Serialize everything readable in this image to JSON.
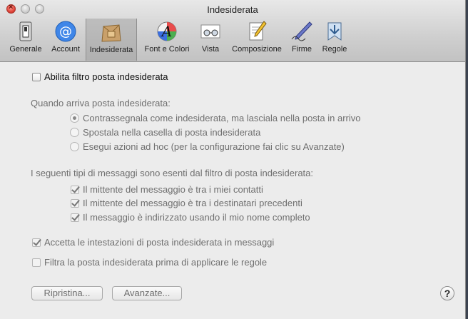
{
  "window": {
    "title": "Indesiderata"
  },
  "toolbar": {
    "items": [
      {
        "label": "Generale",
        "icon": "switch-icon"
      },
      {
        "label": "Account",
        "icon": "at-sign-icon"
      },
      {
        "label": "Indesiderata",
        "icon": "junk-mail-icon",
        "selected": true
      },
      {
        "label": "Font e Colori",
        "icon": "font-colors-icon"
      },
      {
        "label": "Vista",
        "icon": "glasses-icon"
      },
      {
        "label": "Composizione",
        "icon": "compose-pencil-icon"
      },
      {
        "label": "Firme",
        "icon": "signature-pen-icon"
      },
      {
        "label": "Regole",
        "icon": "rules-icon"
      }
    ]
  },
  "settings": {
    "enable_filter": {
      "label": "Abilita filtro posta indesiderata",
      "checked": false
    },
    "when_arrives_label": "Quando arriva posta indesiderata:",
    "radio_options": [
      {
        "label": "Contrassegnala come indesiderata, ma lasciala nella posta in arrivo",
        "selected": true
      },
      {
        "label": "Spostala nella casella di posta indesiderata",
        "selected": false
      },
      {
        "label": "Esegui azioni ad hoc (per la configurazione fai clic su Avanzate)",
        "selected": false
      }
    ],
    "exempt_label": "I seguenti tipi di messaggi sono esenti dal filtro di posta indesiderata:",
    "exempt_options": [
      {
        "label": "Il mittente del messaggio è tra i miei contatti",
        "checked": true
      },
      {
        "label": "Il mittente del messaggio è tra i destinatari precedenti",
        "checked": true
      },
      {
        "label": "Il messaggio è indirizzato usando il mio nome completo",
        "checked": true
      }
    ],
    "trust_headers": {
      "label": "Accetta le intestazioni di posta indesiderata in messaggi",
      "checked": true
    },
    "filter_before_rules": {
      "label": "Filtra la posta indesiderata prima di applicare le regole",
      "checked": false
    }
  },
  "buttons": {
    "reset": "Ripristina...",
    "advanced": "Avanzate...",
    "help": "?"
  },
  "colors": {
    "window_bg": "#ececec",
    "toolbar_selected": "#b5b5b5",
    "disabled_text": "#6f6f6f"
  }
}
